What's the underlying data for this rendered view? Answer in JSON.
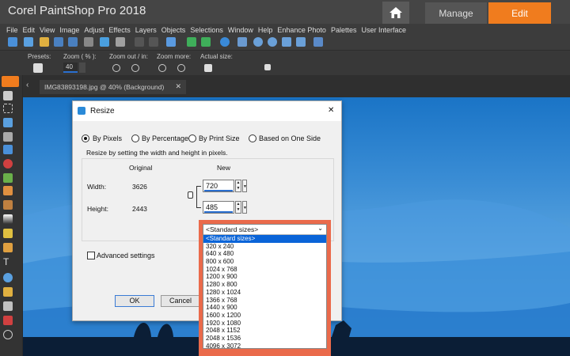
{
  "app": {
    "title": "Corel PaintShop Pro 2018",
    "tabs": {
      "manage": "Manage",
      "edit": "Edit"
    }
  },
  "menu": [
    "File",
    "Edit",
    "View",
    "Image",
    "Adjust",
    "Effects",
    "Layers",
    "Objects",
    "Selections",
    "Window",
    "Help",
    "Enhance Photo",
    "Palettes",
    "User Interface"
  ],
  "tool_options": {
    "presets_label": "Presets:",
    "zoom_label": "Zoom ( % ):",
    "zoom_value": "40",
    "zoom_out_in_label": "Zoom out / in:",
    "zoom_more_label": "Zoom more:",
    "actual_size_label": "Actual size:"
  },
  "document": {
    "tab_label": "IMG83893198.jpg @  40% (Background)"
  },
  "dialog": {
    "title": "Resize",
    "close_label": "✕",
    "radios": [
      "By Pixels",
      "By Percentage",
      "By Print Size",
      "Based on One Side"
    ],
    "selected_radio": "By Pixels",
    "instruction": "Resize by setting the width and height in pixels.",
    "col_original": "Original",
    "col_new": "New",
    "width_label": "Width:",
    "height_label": "Height:",
    "original_width": "3626",
    "original_height": "2443",
    "new_width": "720",
    "new_height": "485",
    "advanced_label": "Advanced settings",
    "ok_label": "OK",
    "cancel_label": "Cancel"
  },
  "standard_sizes": {
    "selected": "<Standard sizes>",
    "options": [
      "<Standard sizes>",
      "320 x 240",
      "640 x 480",
      "800 x 600",
      "1024 x 768",
      "1200 x 900",
      "1280 x 800",
      "1280 x 1024",
      "1366 x 768",
      "1440 x 900",
      "1600 x 1200",
      "1920 x 1080",
      "2048 x 1152",
      "2048 x 1536",
      "4096 x 3072"
    ]
  },
  "colors": {
    "accent_orange": "#f07c1e",
    "highlight": "#ea6a4b",
    "selection_blue": "#0a64d8"
  }
}
